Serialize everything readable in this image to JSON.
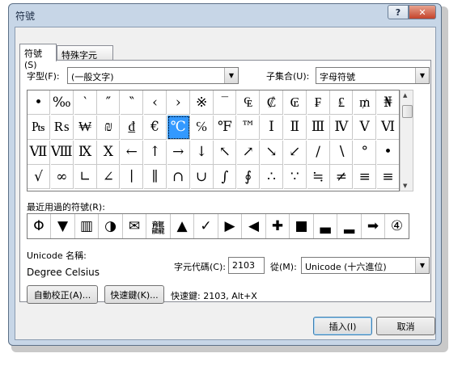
{
  "window": {
    "title": "符號",
    "help_icon": "?",
    "close_icon": "✕"
  },
  "tabs": [
    {
      "label": "符號(S)"
    },
    {
      "label": "特殊字元(P)"
    }
  ],
  "font": {
    "label": "字型(F):",
    "value": "(一般文字)"
  },
  "subset": {
    "label": "子集合(U):",
    "value": "字母符號"
  },
  "symbol_grid": {
    "rows": [
      [
        "•",
        "‰",
        "‵",
        "″",
        "‶",
        "‹",
        "›",
        "※",
        "‾",
        "₠",
        "₡",
        "₢",
        "₣",
        "₤",
        "₥",
        "₦"
      ],
      [
        "₧",
        "₨",
        "₩",
        "₪",
        "₫",
        "€",
        "℃",
        "℅",
        "℉",
        "™",
        "Ⅰ",
        "Ⅱ",
        "Ⅲ",
        "Ⅳ",
        "Ⅴ",
        "Ⅵ"
      ],
      [
        "Ⅶ",
        "Ⅷ",
        "Ⅸ",
        "Ⅹ",
        "←",
        "↑",
        "→",
        "↓",
        "↖",
        "↗",
        "↘",
        "↙",
        "∕",
        "∖",
        "°",
        "•"
      ],
      [
        "√",
        "∞",
        "∟",
        "∠",
        "∣",
        "∥",
        "∩",
        "∪",
        "∫",
        "∮",
        "∴",
        "∵",
        "≒",
        "≠",
        "≡",
        "≡"
      ]
    ],
    "selected": "℃"
  },
  "recent": {
    "label": "最近用過的符號(R):",
    "items": [
      "Φ",
      "▼",
      "▥",
      "◑",
      "✉",
      "龘",
      "▲",
      "✓",
      "▶",
      "◀",
      "✚",
      "■",
      "▃",
      "▂",
      "➡",
      "④"
    ]
  },
  "unicode_name": {
    "label": "Unicode 名稱:",
    "value": "Degree Celsius"
  },
  "char_code": {
    "label": "字元代碼(C):",
    "value": "2103"
  },
  "from": {
    "label": "從(M):",
    "value": "Unicode (十六進位)"
  },
  "buttons": {
    "autocorrect": "自動校正(A)...",
    "shortcut_key": "快速鍵(K)...",
    "shortcut_text": "快速鍵: 2103, Alt+X",
    "insert": "插入(I)",
    "cancel": "取消"
  }
}
